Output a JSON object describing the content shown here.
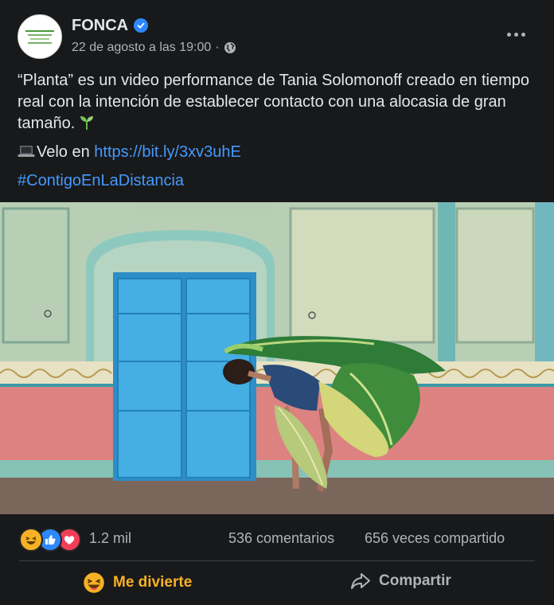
{
  "post": {
    "author": "FONCA",
    "timestamp": "22 de agosto a las 19:00",
    "separator": "·",
    "text_main": "“Planta” es un video performance de Tania Solomonoff creado en tiempo real con la intención de establecer contacto con una alocasia de gran tamaño.",
    "video_prefix": "Velo en ",
    "video_link": "https://bit.ly/3xv3uhE",
    "hashtag": "#ContigoEnLaDistancia"
  },
  "icons": {
    "verified": "verified-badge-icon",
    "audience": "globe-icon",
    "more": "more-options-icon",
    "laptop": "laptop-emoji-icon",
    "sprout": "seedling-emoji-icon"
  },
  "stats": {
    "reactions_count": "1.2 mil",
    "comments": "536 comentarios",
    "shares": "656 veces compartido",
    "reaction_types": [
      "haha",
      "like",
      "love"
    ]
  },
  "actions": {
    "react_label": "Me divierte",
    "share_label": "Compartir"
  },
  "colors": {
    "background": "#18191a",
    "link": "#4599ff",
    "haha": "#f7b125",
    "like": "#2d88ff",
    "love": "#f33e58",
    "door": "#3aa6d9"
  }
}
